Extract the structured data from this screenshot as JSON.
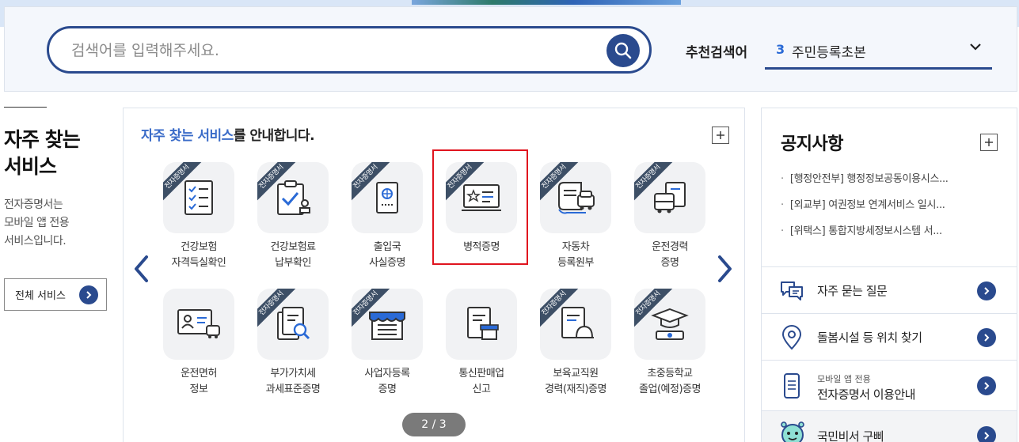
{
  "search": {
    "placeholder": "검색어를 입력해주세요.",
    "recommend_label": "추천검색어",
    "recommend_rank": "3",
    "recommend_term": "주민등록초본"
  },
  "left": {
    "title_line1": "자주 찾는",
    "title_line2": "서비스",
    "desc_line1": "전자증명서는",
    "desc_line2": "모바일 앱 전용",
    "desc_line3": "서비스입니다.",
    "all_button": "전체 서비스"
  },
  "center": {
    "heading_highlight": "자주 찾는 서비스",
    "heading_rest": "를 안내합니다.",
    "ribbon_text": "전자증명서",
    "pager": "2 / 3",
    "services": [
      {
        "label": "건강보험\n자격득실확인",
        "ribbon": true,
        "icon": "checklist-icon"
      },
      {
        "label": "건강보험료\n납부확인",
        "ribbon": true,
        "icon": "clipboard-stamp-icon"
      },
      {
        "label": "출입국\n사실증명",
        "ribbon": true,
        "icon": "passport-icon"
      },
      {
        "label": "병적증명",
        "ribbon": true,
        "icon": "military-id-icon",
        "selected": true
      },
      {
        "label": "자동차\n등록원부",
        "ribbon": true,
        "icon": "car-registration-icon"
      },
      {
        "label": "운전경력\n증명",
        "ribbon": true,
        "icon": "bus-document-icon"
      },
      {
        "label": "운전면허\n정보",
        "ribbon": false,
        "icon": "license-card-icon"
      },
      {
        "label": "부가가치세\n과세표준증명",
        "ribbon": true,
        "icon": "document-search-icon"
      },
      {
        "label": "사업자등록\n증명",
        "ribbon": true,
        "icon": "storefront-icon"
      },
      {
        "label": "통신판매업\n신고",
        "ribbon": false,
        "icon": "document-shop-icon"
      },
      {
        "label": "보육교직원\n경력(재직)증명",
        "ribbon": true,
        "icon": "document-helmet-icon"
      },
      {
        "label": "초중등학교\n졸업(예정)증명",
        "ribbon": true,
        "icon": "graduation-cap-icon"
      }
    ]
  },
  "right": {
    "notice_title": "공지사항",
    "notices": [
      "[행정안전부] 행정정보공동이용시스...",
      "[외교부] 여권정보 연계서비스 일시...",
      "[위택스] 통합지방세정보시스템 서..."
    ],
    "quick_links": [
      {
        "text": "자주 묻는 질문",
        "icon": "chat-bubbles-icon"
      },
      {
        "text": "돌봄시설 등 위치 찾기",
        "icon": "location-pin-icon"
      },
      {
        "sub": "모바일 앱 전용",
        "text": "전자증명서 이용안내",
        "icon": "mobile-document-icon"
      },
      {
        "text": "국민비서 구삐",
        "icon": "mascot-icon"
      }
    ]
  },
  "colors": {
    "primary": "#2a4a8e",
    "highlight": "#3a6bc8",
    "selection": "#e0141e",
    "ribbon": "#3d4f66"
  }
}
